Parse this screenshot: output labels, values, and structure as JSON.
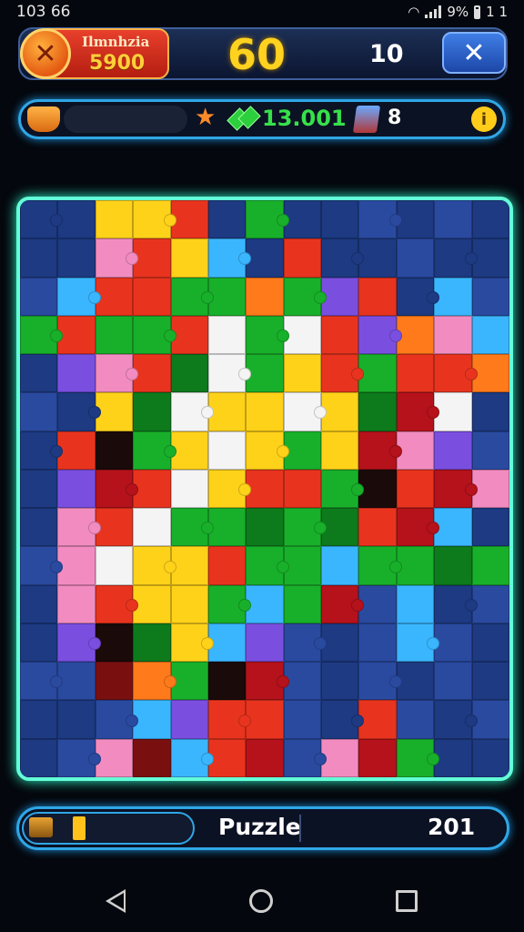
{
  "status_bar": {
    "time": "103 66",
    "battery": "9%",
    "right_extra": "1 1"
  },
  "header": {
    "player_name": "Ilmnhzia",
    "player_score": "5900",
    "timer": "60",
    "moves": "10",
    "close_icon": "close-x-icon"
  },
  "resources": {
    "amount": "13.001",
    "extra": "8",
    "coin_label": "i"
  },
  "board": {
    "palette": {
      "B": "#1d3a82",
      "b": "#2a4aa0",
      "R": "#e8341e",
      "r": "#b5121b",
      "G": "#18b02a",
      "g": "#0d7a1c",
      "Y": "#ffd21a",
      "W": "#f4f4f4",
      "P": "#f28cc0",
      "C": "#3ab6ff",
      "V": "#7a4fe0",
      "O": "#ff7a1a",
      "K": "#1a0a0a",
      "M": "#7a0f10"
    },
    "rows": [
      "BBYYRBGBBbBbB",
      "BBPRYCBRBBbBB",
      "bCRRGGOGVRBCb",
      "GRGGRWGWRVOPC",
      "BVPRgWGYRGRRO",
      "bBYgWYYWYgrWB",
      "BRKGYWYGYrPVb",
      "BVrRWYRRGKRrP",
      "BPRWGGgGgRrCB",
      "bPWYYRGGCGGgG",
      "BPRYYGCGrbCBb",
      "BVKgYCVbBbCbB",
      "bbMOGKrbBbBbB",
      "BBbCVRRbBRbBb",
      "BbPMCRrbPrGBB"
    ]
  },
  "footer": {
    "title": "Puzzle",
    "level": "201"
  },
  "nav": {
    "back": "back-icon",
    "home": "home-icon",
    "recents": "recents-icon"
  }
}
